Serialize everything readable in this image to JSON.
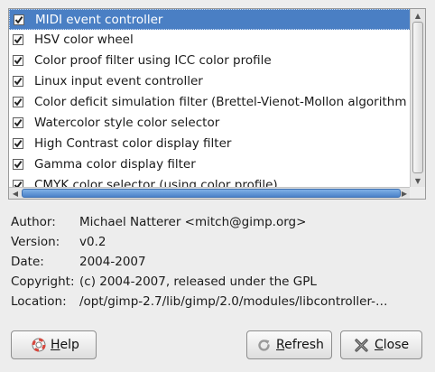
{
  "modules": {
    "items": [
      {
        "label": "MIDI event controller",
        "checked": true,
        "selected": true
      },
      {
        "label": "HSV color wheel",
        "checked": true,
        "selected": false
      },
      {
        "label": "Color proof filter using ICC color profile",
        "checked": true,
        "selected": false
      },
      {
        "label": "Linux input event controller",
        "checked": true,
        "selected": false
      },
      {
        "label": "Color deficit simulation filter (Brettel-Vienot-Mollon algorithm",
        "checked": true,
        "selected": false
      },
      {
        "label": "Watercolor style color selector",
        "checked": true,
        "selected": false
      },
      {
        "label": "High Contrast color display filter",
        "checked": true,
        "selected": false
      },
      {
        "label": "Gamma color display filter",
        "checked": true,
        "selected": false
      },
      {
        "label": "CMYK color selector (using color profile)",
        "checked": true,
        "selected": false
      }
    ]
  },
  "info": {
    "author_label": "Author:",
    "author_value": "Michael Natterer <mitch@gimp.org>",
    "version_label": "Version:",
    "version_value": "v0.2",
    "date_label": "Date:",
    "date_value": "2004-2007",
    "copyright_label": "Copyright:",
    "copyright_value": "(c) 2004-2007, released under the GPL",
    "location_label": "Location:",
    "location_value": "/opt/gimp-2.7/lib/gimp/2.0/modules/libcontroller-…"
  },
  "buttons": {
    "help_mnemonic": "H",
    "help_rest": "elp",
    "refresh_mnemonic": "R",
    "refresh_rest": "efresh",
    "close_mnemonic": "C",
    "close_rest": "lose"
  },
  "colors": {
    "selection": "#4a7fc4",
    "background": "#ededed"
  },
  "icons": {
    "help": "help-lifebuoy-icon",
    "refresh": "refresh-icon",
    "close": "close-x-icon"
  }
}
